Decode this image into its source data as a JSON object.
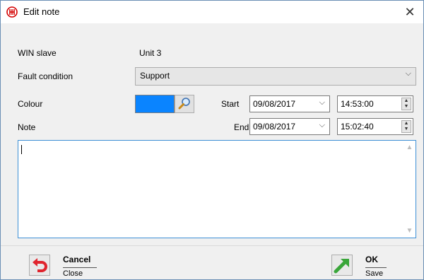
{
  "window": {
    "title": "Edit note",
    "close_glyph": "✕",
    "icon": "app-logo-icon",
    "accent": "#d40000"
  },
  "form": {
    "win_slave_label": "WIN slave",
    "win_slave_value": "Unit 3",
    "fault_condition_label": "Fault condition",
    "fault_condition_value": "Support",
    "colour_label": "Colour",
    "colour_value": "#0a84ff",
    "note_label": "Note",
    "start_label": "Start",
    "start_date": "09/08/2017",
    "start_time": "14:53:00",
    "end_label": "End",
    "end_date": "09/08/2017",
    "end_time": "15:02:40",
    "note_text": ""
  },
  "footer": {
    "cancel_label": "Cancel",
    "cancel_sub": "Close",
    "ok_label": "OK",
    "ok_sub": "Save"
  }
}
